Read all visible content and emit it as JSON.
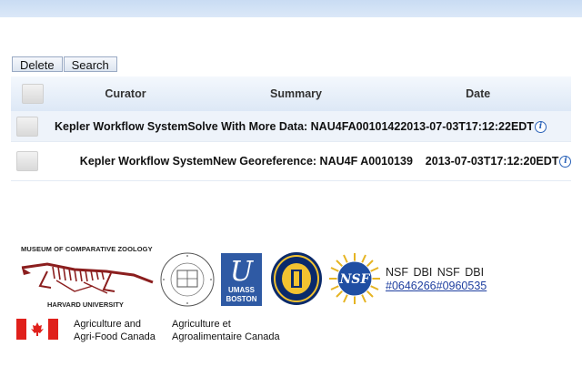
{
  "toolbar": {
    "delete_label": "Delete",
    "search_label": "Search"
  },
  "table": {
    "columns": [
      "Curator",
      "Summary",
      "Date"
    ],
    "rows": [
      {
        "text": "Kepler Workflow SystemSolve With More Data: NAU4FA00101422013-07-03T17:12:22EDT"
      },
      {
        "text": "Kepler Workflow SystemNew Georeference: NAU4F A0010139    2013-07-03T17:12:20EDT"
      }
    ]
  },
  "logos": {
    "mcz_title": "MUSEUM OF COMPARATIVE ZOOLOGY",
    "mcz_subtitle": "HARVARD UNIVERSITY",
    "umass_lines": [
      "UMASS",
      "BOSTON"
    ],
    "nsf_label": "NSF DBI NSF DBI",
    "nsf_links": [
      "#0646266",
      "#0960535"
    ],
    "agri_en": [
      "Agriculture and",
      "Agri-Food Canada"
    ],
    "agri_fr": [
      "Agriculture et",
      "Agroalimentaire Canada"
    ]
  },
  "icon_names": {
    "info": "info-icon",
    "fossil": "fossil-skeleton-logo",
    "flag": "canada-flag-icon"
  },
  "colors": {
    "header_band": "#c9dcf3",
    "link": "#2040a0",
    "umass_blue": "#2f5aa4"
  }
}
